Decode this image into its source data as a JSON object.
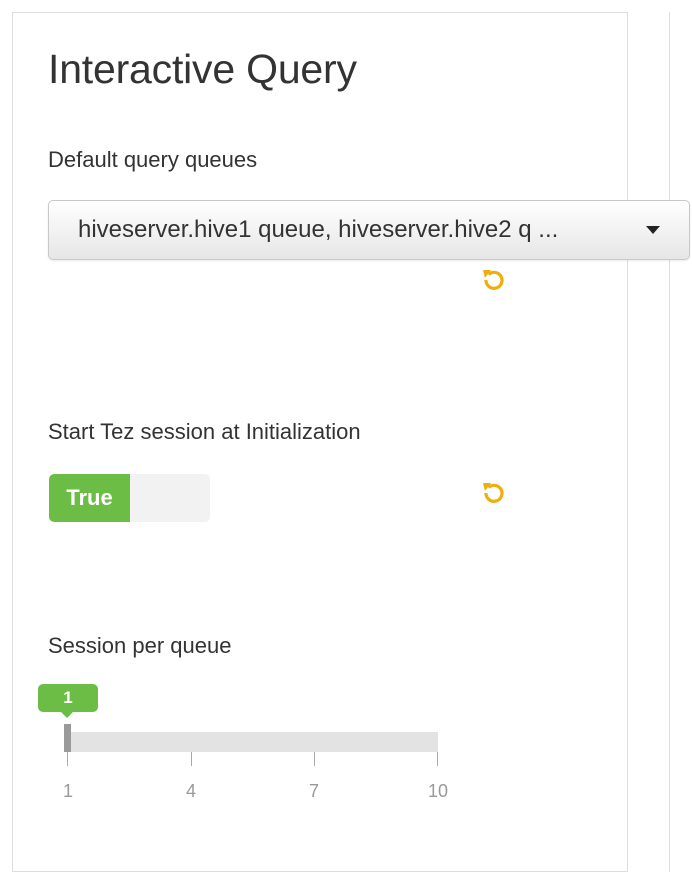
{
  "panel": {
    "title": "Interactive Query"
  },
  "default_query_queues": {
    "label": "Default query queues",
    "value": "hiveserver.hive1 queue, hiveserver.hive2 q ..."
  },
  "tez_session": {
    "label": "Start Tez session at Initialization",
    "toggle_label": "True",
    "enabled": true
  },
  "session_per_queue": {
    "label": "Session per queue",
    "value": "1",
    "min": 1,
    "max": 10,
    "ticks": [
      "1",
      "4",
      "7",
      "10"
    ]
  },
  "icons": {
    "undo": "undo-icon",
    "dropdown_caret": "caret-down-icon"
  },
  "colors": {
    "accent_green": "#6bbd45",
    "undo_orange": "#f0ad0e",
    "text": "#333333"
  }
}
